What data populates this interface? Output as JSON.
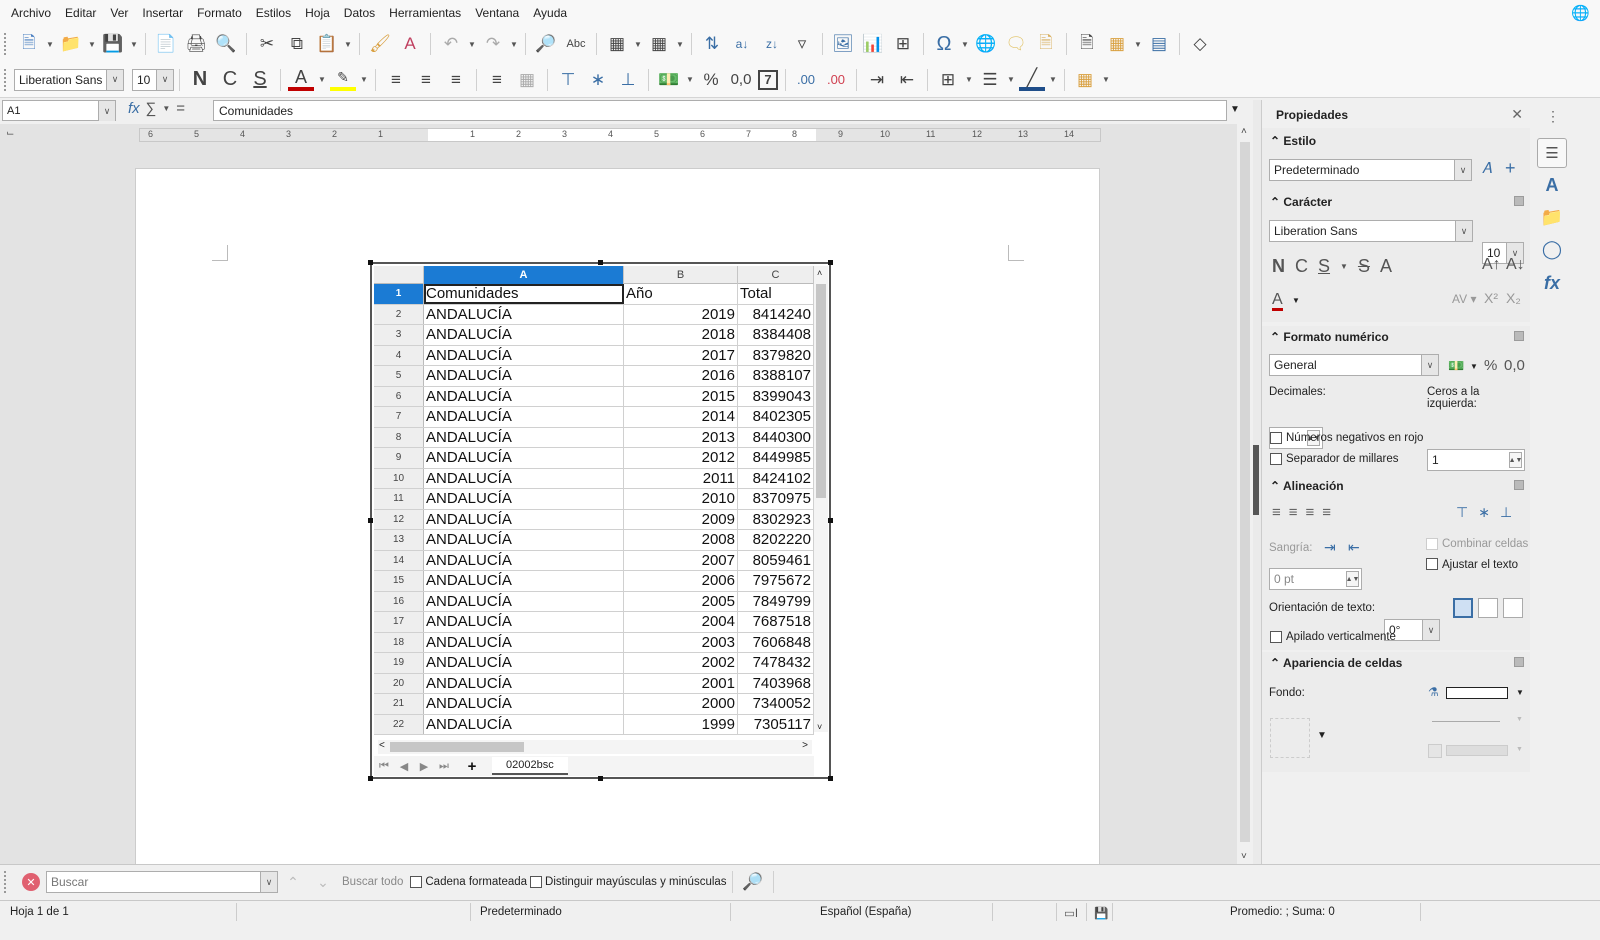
{
  "menubar": {
    "items": [
      "Archivo",
      "Editar",
      "Ver",
      "Insertar",
      "Formato",
      "Estilos",
      "Hoja",
      "Datos",
      "Herramientas",
      "Ventana",
      "Ayuda"
    ]
  },
  "toolbar_standard": {
    "icons": [
      "new-document-icon",
      "open-folder-icon",
      "save-icon",
      "export-pdf-icon",
      "print-icon",
      "print-preview-icon",
      "cut-icon",
      "copy-icon",
      "paste-icon",
      "clone-formatting-icon",
      "clear-formatting-icon",
      "undo-icon",
      "redo-icon",
      "find-replace-icon",
      "spellcheck-icon",
      "row-icon",
      "column-icon",
      "sort-icon",
      "sort-ascending-icon",
      "sort-descending-icon",
      "autofilter-icon",
      "insert-image-icon",
      "insert-chart-icon",
      "pivot-table-icon",
      "special-character-icon",
      "hyperlink-icon",
      "comment-icon",
      "headers-footers-icon",
      "print-range-icon",
      "freeze-rows-columns-icon",
      "split-window-icon",
      "show-draw-functions-icon"
    ]
  },
  "toolbar_formatting": {
    "font_name": "Liberation Sans",
    "font_size": "10",
    "bold": "N",
    "italic": "C",
    "underline": "S",
    "font_color": "#c00000",
    "highlight_color": "#ffff00",
    "percent": "%",
    "number_format": "0,0",
    "date_format": "7",
    "add_decimal": ".00",
    "remove_decimal": ".00"
  },
  "formula_bar": {
    "name_box": "A1",
    "content": "Comunidades"
  },
  "ruler": {
    "left_ticks": [
      "6",
      "5",
      "4",
      "3",
      "2",
      "1"
    ],
    "right_ticks": [
      "1",
      "2",
      "3",
      "4",
      "5",
      "6",
      "7",
      "8",
      "9",
      "10",
      "11",
      "12",
      "13",
      "14"
    ]
  },
  "sheet": {
    "columns": [
      "A",
      "B",
      "C"
    ],
    "selected_column": "A",
    "active_cell": "A1",
    "rows": [
      {
        "n": "1",
        "a": "Comunidades",
        "b": "Año",
        "c": "Total",
        "header": true
      },
      {
        "n": "2",
        "a": "ANDALUCÍA",
        "b": "2019",
        "c": "8414240"
      },
      {
        "n": "3",
        "a": "ANDALUCÍA",
        "b": "2018",
        "c": "8384408"
      },
      {
        "n": "4",
        "a": "ANDALUCÍA",
        "b": "2017",
        "c": "8379820"
      },
      {
        "n": "5",
        "a": "ANDALUCÍA",
        "b": "2016",
        "c": "8388107"
      },
      {
        "n": "6",
        "a": "ANDALUCÍA",
        "b": "2015",
        "c": "8399043"
      },
      {
        "n": "7",
        "a": "ANDALUCÍA",
        "b": "2014",
        "c": "8402305"
      },
      {
        "n": "8",
        "a": "ANDALUCÍA",
        "b": "2013",
        "c": "8440300"
      },
      {
        "n": "9",
        "a": "ANDALUCÍA",
        "b": "2012",
        "c": "8449985"
      },
      {
        "n": "10",
        "a": "ANDALUCÍA",
        "b": "2011",
        "c": "8424102"
      },
      {
        "n": "11",
        "a": "ANDALUCÍA",
        "b": "2010",
        "c": "8370975"
      },
      {
        "n": "12",
        "a": "ANDALUCÍA",
        "b": "2009",
        "c": "8302923"
      },
      {
        "n": "13",
        "a": "ANDALUCÍA",
        "b": "2008",
        "c": "8202220"
      },
      {
        "n": "14",
        "a": "ANDALUCÍA",
        "b": "2007",
        "c": "8059461"
      },
      {
        "n": "15",
        "a": "ANDALUCÍA",
        "b": "2006",
        "c": "7975672"
      },
      {
        "n": "16",
        "a": "ANDALUCÍA",
        "b": "2005",
        "c": "7849799"
      },
      {
        "n": "17",
        "a": "ANDALUCÍA",
        "b": "2004",
        "c": "7687518"
      },
      {
        "n": "18",
        "a": "ANDALUCÍA",
        "b": "2003",
        "c": "7606848"
      },
      {
        "n": "19",
        "a": "ANDALUCÍA",
        "b": "2002",
        "c": "7478432"
      },
      {
        "n": "20",
        "a": "ANDALUCÍA",
        "b": "2001",
        "c": "7403968"
      },
      {
        "n": "21",
        "a": "ANDALUCÍA",
        "b": "2000",
        "c": "7340052"
      },
      {
        "n": "22",
        "a": "ANDALUCÍA",
        "b": "1999",
        "c": "7305117"
      }
    ],
    "tab_name": "02002bsc",
    "selection_color": "#1b7bd4"
  },
  "sidebar": {
    "title": "Propiedades",
    "estilo": {
      "heading": "Estilo",
      "style_value": "Predeterminado"
    },
    "caracter": {
      "heading": "Carácter",
      "font": "Liberation Sans",
      "size": "10"
    },
    "formato_numerico": {
      "heading": "Formato numérico",
      "format": "General",
      "decimales_label": "Decimales:",
      "decimales_value": "",
      "ceros_label": "Ceros a la izquierda:",
      "ceros_value": "1",
      "negativos_label": "Números negativos en rojo",
      "negativos_checked": false,
      "separador_label": "Separador de millares",
      "separador_checked": false,
      "percent": "%",
      "number": "0,0"
    },
    "alineacion": {
      "heading": "Alineación",
      "sangria_label": "Sangría:",
      "sangria_value": "0 pt",
      "combinar_label": "Combinar celdas",
      "ajustar_label": "Ajustar el texto",
      "orientacion_label": "Orientación de texto:",
      "orientacion_value": "0°",
      "apilado_label": "Apilado verticalmente"
    },
    "apariencia": {
      "heading": "Apariencia de celdas",
      "fondo_label": "Fondo:"
    }
  },
  "findbar": {
    "placeholder": "Buscar",
    "find_all": "Buscar todo",
    "formatted_label": "Cadena formateada",
    "match_case_label": "Distinguir mayúsculas y minúsculas"
  },
  "statusbar": {
    "sheet": "Hoja 1 de 1",
    "style": "Predeterminado",
    "language": "Español (España)",
    "summary": "Promedio: ; Suma: 0"
  }
}
